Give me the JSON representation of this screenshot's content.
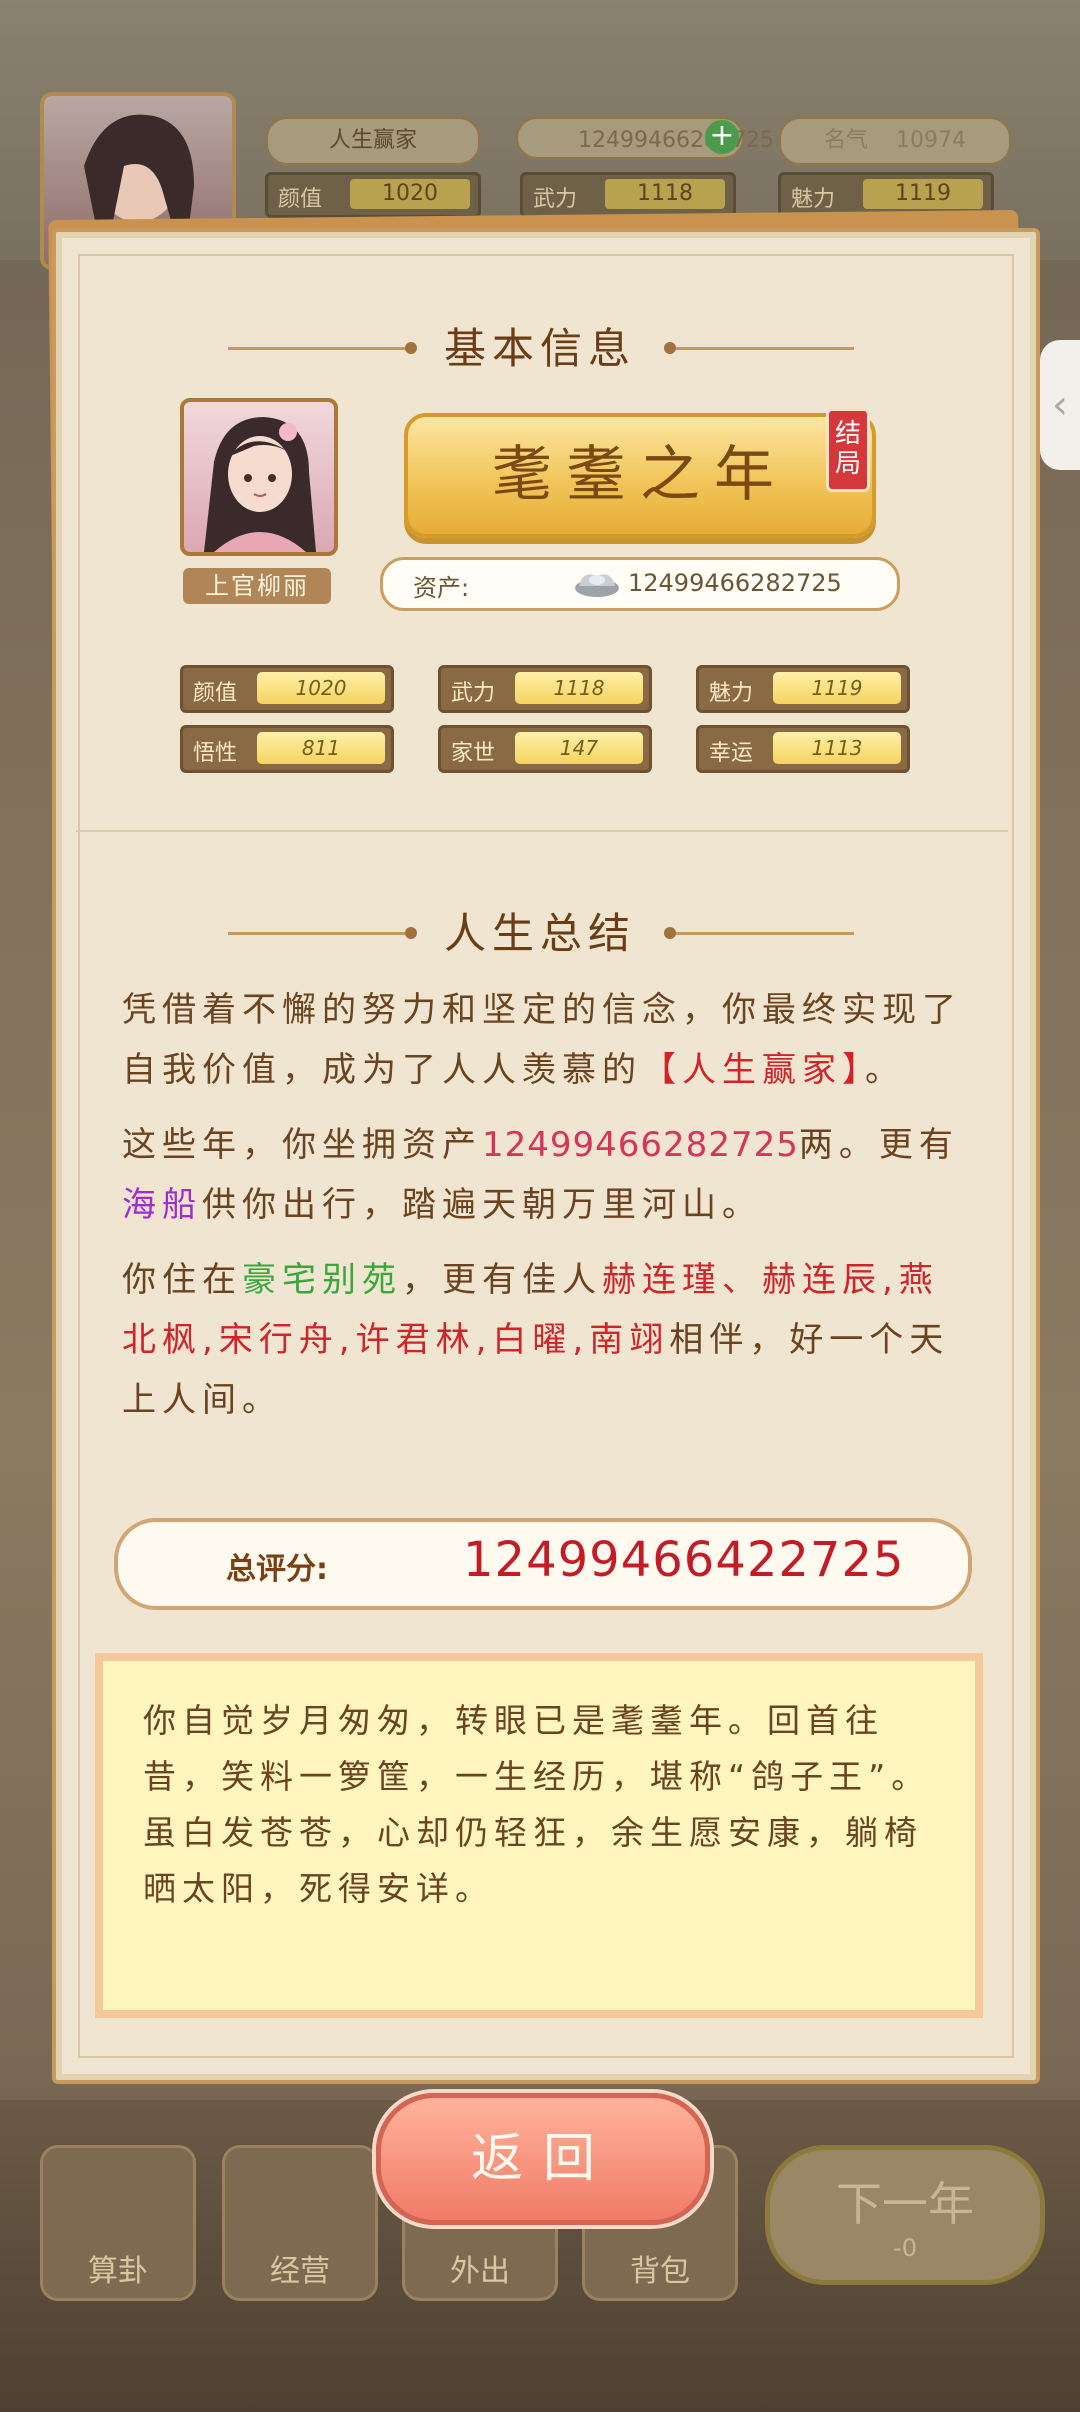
{
  "hud": {
    "status_label": "人生赢家",
    "silver": "12499466282725",
    "fame_label": "名气",
    "fame_value": "10974",
    "stats": [
      {
        "label": "颜值",
        "value": "1020"
      },
      {
        "label": "武力",
        "value": "1118"
      },
      {
        "label": "魅力",
        "value": "1119"
      }
    ]
  },
  "basic": {
    "title": "基本信息",
    "name": "上官柳丽",
    "age_title": "耄耋之年",
    "end_tag": "结局",
    "asset_label": "资产:",
    "asset_value": "12499466282725",
    "stats": [
      {
        "label": "颜值",
        "value": "1020"
      },
      {
        "label": "武力",
        "value": "1118"
      },
      {
        "label": "魅力",
        "value": "1119"
      },
      {
        "label": "悟性",
        "value": "811"
      },
      {
        "label": "家世",
        "value": "147"
      },
      {
        "label": "幸运",
        "value": "1113"
      }
    ]
  },
  "summary": {
    "title": "人生总结",
    "p1_a": "凭借着不懈的努力和坚定的信念，你最终实现了自我价值，成为了人人羡慕的",
    "p1_hl": "【人生赢家】",
    "p1_b": "。",
    "p2_a": "这些年，你坐拥资产",
    "p2_amt": "12499466282725",
    "p2_b": "两。更有",
    "p2_ship": "海船",
    "p2_c": "供你出行，踏遍天朝万里河山。",
    "p3_a": "你住在",
    "p3_home": "豪宅别苑",
    "p3_b": "，更有佳人",
    "p3_people": "赫连瑾、赫连辰,燕北枫,宋行舟,许君林,白曜,南翊",
    "p3_c": "相伴，好一个天上人间。"
  },
  "score": {
    "label": "总评分:",
    "value": "12499466422725"
  },
  "note": "你自觉岁月匆匆，转眼已是耄耋年。回首往昔，笑料一箩筐，一生经历，堪称“鸽子王”。虽白发苍苍，心却仍轻狂，余生愿安康，躺椅晒太阳，死得安详。",
  "back_label": "返回",
  "bottom_nav": [
    "算卦",
    "经营",
    "外出",
    "背包"
  ],
  "next_label": "下一年",
  "next_cost": "-0",
  "side_tab": "‹"
}
